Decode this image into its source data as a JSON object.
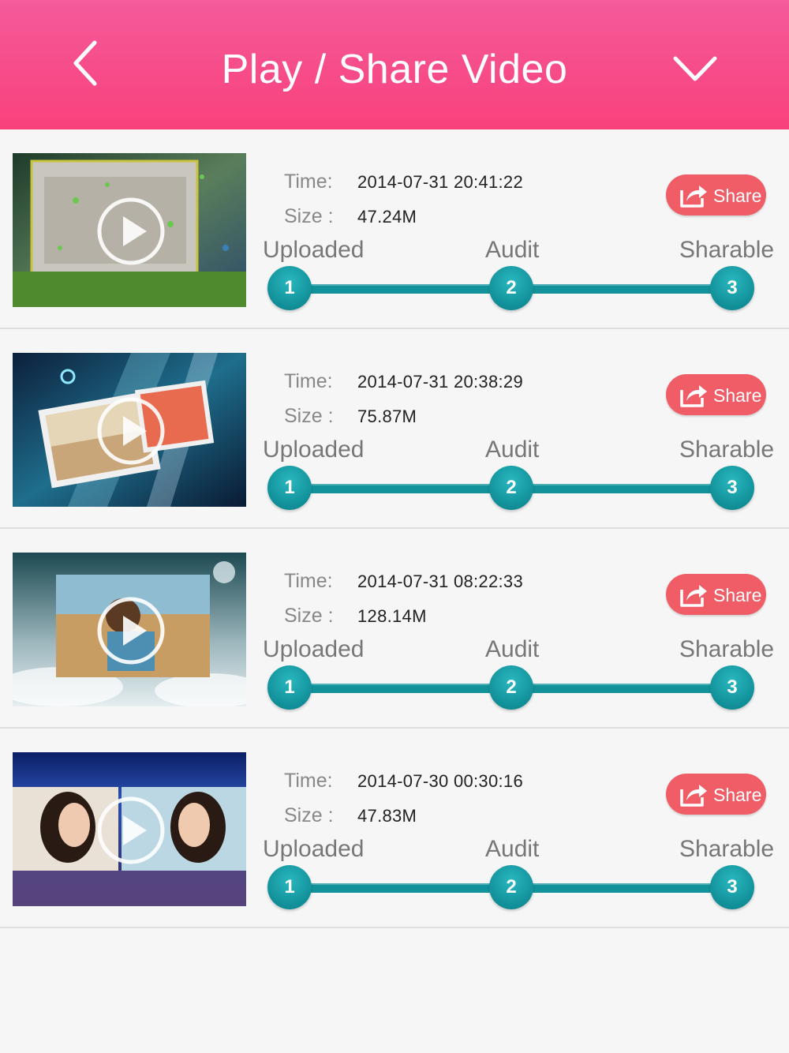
{
  "header": {
    "title": "Play / Share Video",
    "back_icon": "chevron-left-icon",
    "menu_icon": "chevron-down-icon"
  },
  "labels": {
    "time": "Time:",
    "size": "Size :",
    "share": "Share",
    "steps": [
      "Uploaded",
      "Audit",
      "Sharable"
    ],
    "step_numbers": [
      "1",
      "2",
      "3"
    ]
  },
  "colors": {
    "header_top": "#f55a9a",
    "header_bottom": "#f8417c",
    "share_button": "#f05d67",
    "progress": "#12939c"
  },
  "videos": [
    {
      "time": "2014-07-31 20:41:22",
      "size": "47.24M"
    },
    {
      "time": "2014-07-31 20:38:29",
      "size": "75.87M"
    },
    {
      "time": "2014-07-31 08:22:33",
      "size": "128.14M"
    },
    {
      "time": "2014-07-30 00:30:16",
      "size": "47.83M"
    }
  ]
}
